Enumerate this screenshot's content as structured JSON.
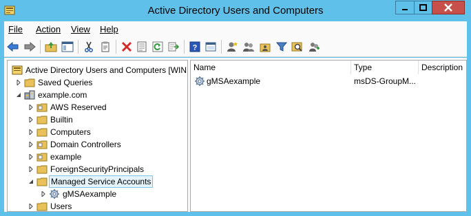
{
  "window": {
    "title": "Active Directory Users and Computers"
  },
  "menu": [
    "File",
    "Action",
    "View",
    "Help"
  ],
  "toolbar": {
    "icons": [
      "back-arrow-icon",
      "forward-arrow-icon",
      "up-folder-icon",
      "show-hide-tree-icon",
      "cut-icon",
      "copy-icon",
      "delete-icon",
      "properties-icon",
      "refresh-icon",
      "export-list-icon",
      "help-icon",
      "show-console-tree-icon",
      "new-user-icon",
      "new-group-icon",
      "new-ou-icon",
      "filter-icon",
      "find-icon",
      "add-to-group-icon"
    ]
  },
  "tree": {
    "root": "Active Directory Users and Computers [WIN",
    "saved_queries": "Saved Queries",
    "domain": "example.com",
    "items": [
      "AWS Reserved",
      "Builtin",
      "Computers",
      "Domain Controllers",
      "example",
      "ForeignSecurityPrincipals",
      "Managed Service Accounts"
    ],
    "child": "gMSAexample",
    "last_item": "Users"
  },
  "list": {
    "columns": [
      "Name",
      "Type",
      "Description"
    ],
    "rows": [
      {
        "name": "gMSAexample",
        "type": "msDS-GroupM..."
      }
    ]
  },
  "colors": {
    "titlebar": "#5fc1e9",
    "close_button": "#c7504a",
    "selection_border": "#7ec4ea",
    "folder": "#e8c15a"
  }
}
